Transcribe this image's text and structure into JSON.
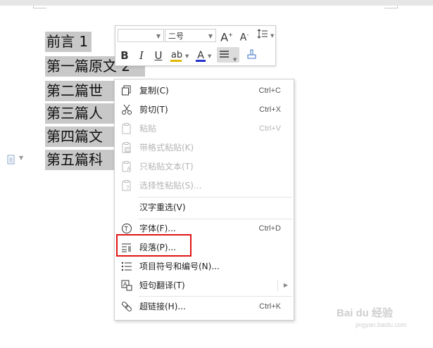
{
  "document": {
    "lines": [
      "前言 1",
      "第一篇原文 2",
      "第二篇世",
      "第三篇人",
      "第四篇文",
      "第五篇科"
    ]
  },
  "toolbar": {
    "font_name": "",
    "font_size": "二号",
    "grow_font": "A",
    "shrink_font": "A",
    "bold": "B",
    "italic": "I",
    "underline": "U",
    "highlight": "ab",
    "font_color": "A",
    "font_color_hex": "#2233cc",
    "highlight_hex": "#e0b800"
  },
  "context_menu": {
    "items": [
      {
        "label": "复制(C)",
        "shortcut": "Ctrl+C",
        "icon": "copy-icon",
        "disabled": false
      },
      {
        "label": "剪切(T)",
        "shortcut": "Ctrl+X",
        "icon": "scissors-icon",
        "disabled": false
      },
      {
        "label": "粘贴",
        "shortcut": "Ctrl+V",
        "icon": "paste-icon",
        "disabled": true
      },
      {
        "label": "带格式粘贴(K)",
        "shortcut": "",
        "icon": "paste-formatted-icon",
        "disabled": true
      },
      {
        "label": "只粘贴文本(T)",
        "shortcut": "",
        "icon": "paste-text-icon",
        "disabled": true
      },
      {
        "label": "选择性粘贴(S)...",
        "shortcut": "",
        "icon": "paste-special-icon",
        "disabled": true
      },
      {
        "label": "汉字重选(V)",
        "shortcut": "",
        "icon": "",
        "disabled": false
      },
      {
        "label": "字体(F)...",
        "shortcut": "Ctrl+D",
        "icon": "font-icon",
        "disabled": false
      },
      {
        "label": "段落(P)...",
        "shortcut": "",
        "icon": "paragraph-icon",
        "disabled": false
      },
      {
        "label": "项目符号和编号(N)...",
        "shortcut": "",
        "icon": "bullet-list-icon",
        "disabled": false
      },
      {
        "label": "短句翻译(T)",
        "shortcut": "",
        "icon": "translate-icon",
        "disabled": false
      },
      {
        "label": "超链接(H)...",
        "shortcut": "Ctrl+K",
        "icon": "link-icon",
        "disabled": false
      }
    ]
  },
  "highlight_color": "#e01414",
  "watermark": {
    "text": "Bai du 经验",
    "url": "jingyan.baidu.com"
  }
}
